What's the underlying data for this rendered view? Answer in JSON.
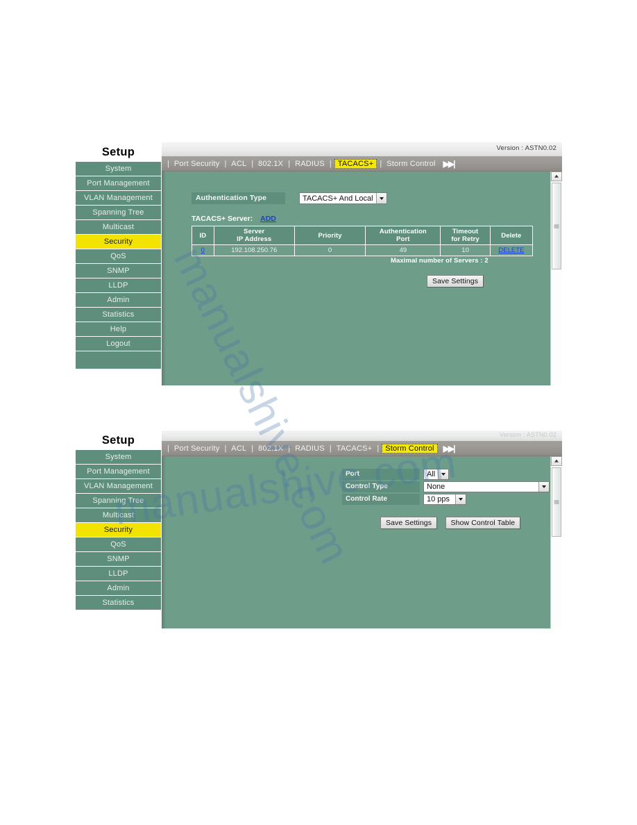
{
  "sidebar": {
    "title": "Setup",
    "items": [
      {
        "label": "System",
        "active": false
      },
      {
        "label": "Port Management",
        "active": false
      },
      {
        "label": "VLAN Management",
        "active": false
      },
      {
        "label": "Spanning Tree",
        "active": false
      },
      {
        "label": "Multicast",
        "active": false
      },
      {
        "label": "Security",
        "active": true
      },
      {
        "label": "QoS",
        "active": false
      },
      {
        "label": "SNMP",
        "active": false
      },
      {
        "label": "LLDP",
        "active": false
      },
      {
        "label": "Admin",
        "active": false
      },
      {
        "label": "Statistics",
        "active": false
      },
      {
        "label": "Help",
        "active": false
      },
      {
        "label": "Logout",
        "active": false
      }
    ]
  },
  "panel_tacacs": {
    "version": "Version :  ASTN0.02",
    "tabs": [
      {
        "label": "Port Security",
        "active": false
      },
      {
        "label": "ACL",
        "active": false
      },
      {
        "label": "802.1X",
        "active": false
      },
      {
        "label": "RADIUS",
        "active": false
      },
      {
        "label": "TACACS+",
        "active": true
      },
      {
        "label": "Storm Control",
        "active": false
      }
    ],
    "next_tabs_icon": "next-tabs-icon",
    "auth_type_label": "Authentication Type",
    "auth_type_value": "TACACS+ And Local",
    "server_section_label": "TACACS+ Server:",
    "add_link": "ADD",
    "table": {
      "headers": [
        "ID",
        "Server\nIP Address",
        "Priority",
        "Authentication\nPort",
        "Timeout\nfor Retry",
        "Delete"
      ],
      "header_id": "ID",
      "header_ip_line1": "Server",
      "header_ip_line2": "IP Address",
      "header_priority": "Priority",
      "header_authport_line1": "Authentication",
      "header_authport_line2": "Port",
      "header_timeout_line1": "Timeout",
      "header_timeout_line2": "for Retry",
      "header_delete": "Delete",
      "rows": [
        {
          "id": "0",
          "ip": "192.108.250.76",
          "priority": "0",
          "auth_port": "49",
          "timeout": "10",
          "delete": "DELETE"
        }
      ]
    },
    "max_servers_note": "Maximal number of Servers : 2",
    "save_button": "Save Settings"
  },
  "panel_storm": {
    "version": "Version :  ASTN0.02",
    "tabs": [
      {
        "label": "Port Security",
        "active": false
      },
      {
        "label": "ACL",
        "active": false
      },
      {
        "label": "802.1X",
        "active": false
      },
      {
        "label": "RADIUS",
        "active": false
      },
      {
        "label": "TACACS+",
        "active": false
      },
      {
        "label": "Storm Control",
        "active": true
      }
    ],
    "next_tabs_icon": "next-tabs-icon",
    "fields": [
      {
        "label": "Port",
        "value": "All"
      },
      {
        "label": "Control Type",
        "value": "None"
      },
      {
        "label": "Control Rate",
        "value": "10 pps"
      }
    ],
    "port_label": "Port",
    "port_value": "All",
    "control_type_label": "Control Type",
    "control_type_value": "None",
    "control_rate_label": "Control Rate",
    "control_rate_value": "10 pps",
    "save_button": "Save Settings",
    "show_table_button": "Show Control Table"
  },
  "watermark": {
    "line1": "manualshive.com",
    "line2": "manualshive.com"
  },
  "colors": {
    "panel_green": "#6e9d8a",
    "sidebar_green": "#5e8f7d",
    "active_yellow": "#f2e300",
    "tabbar_gray": "#9b9894",
    "link_blue": "#1d3fd4"
  }
}
